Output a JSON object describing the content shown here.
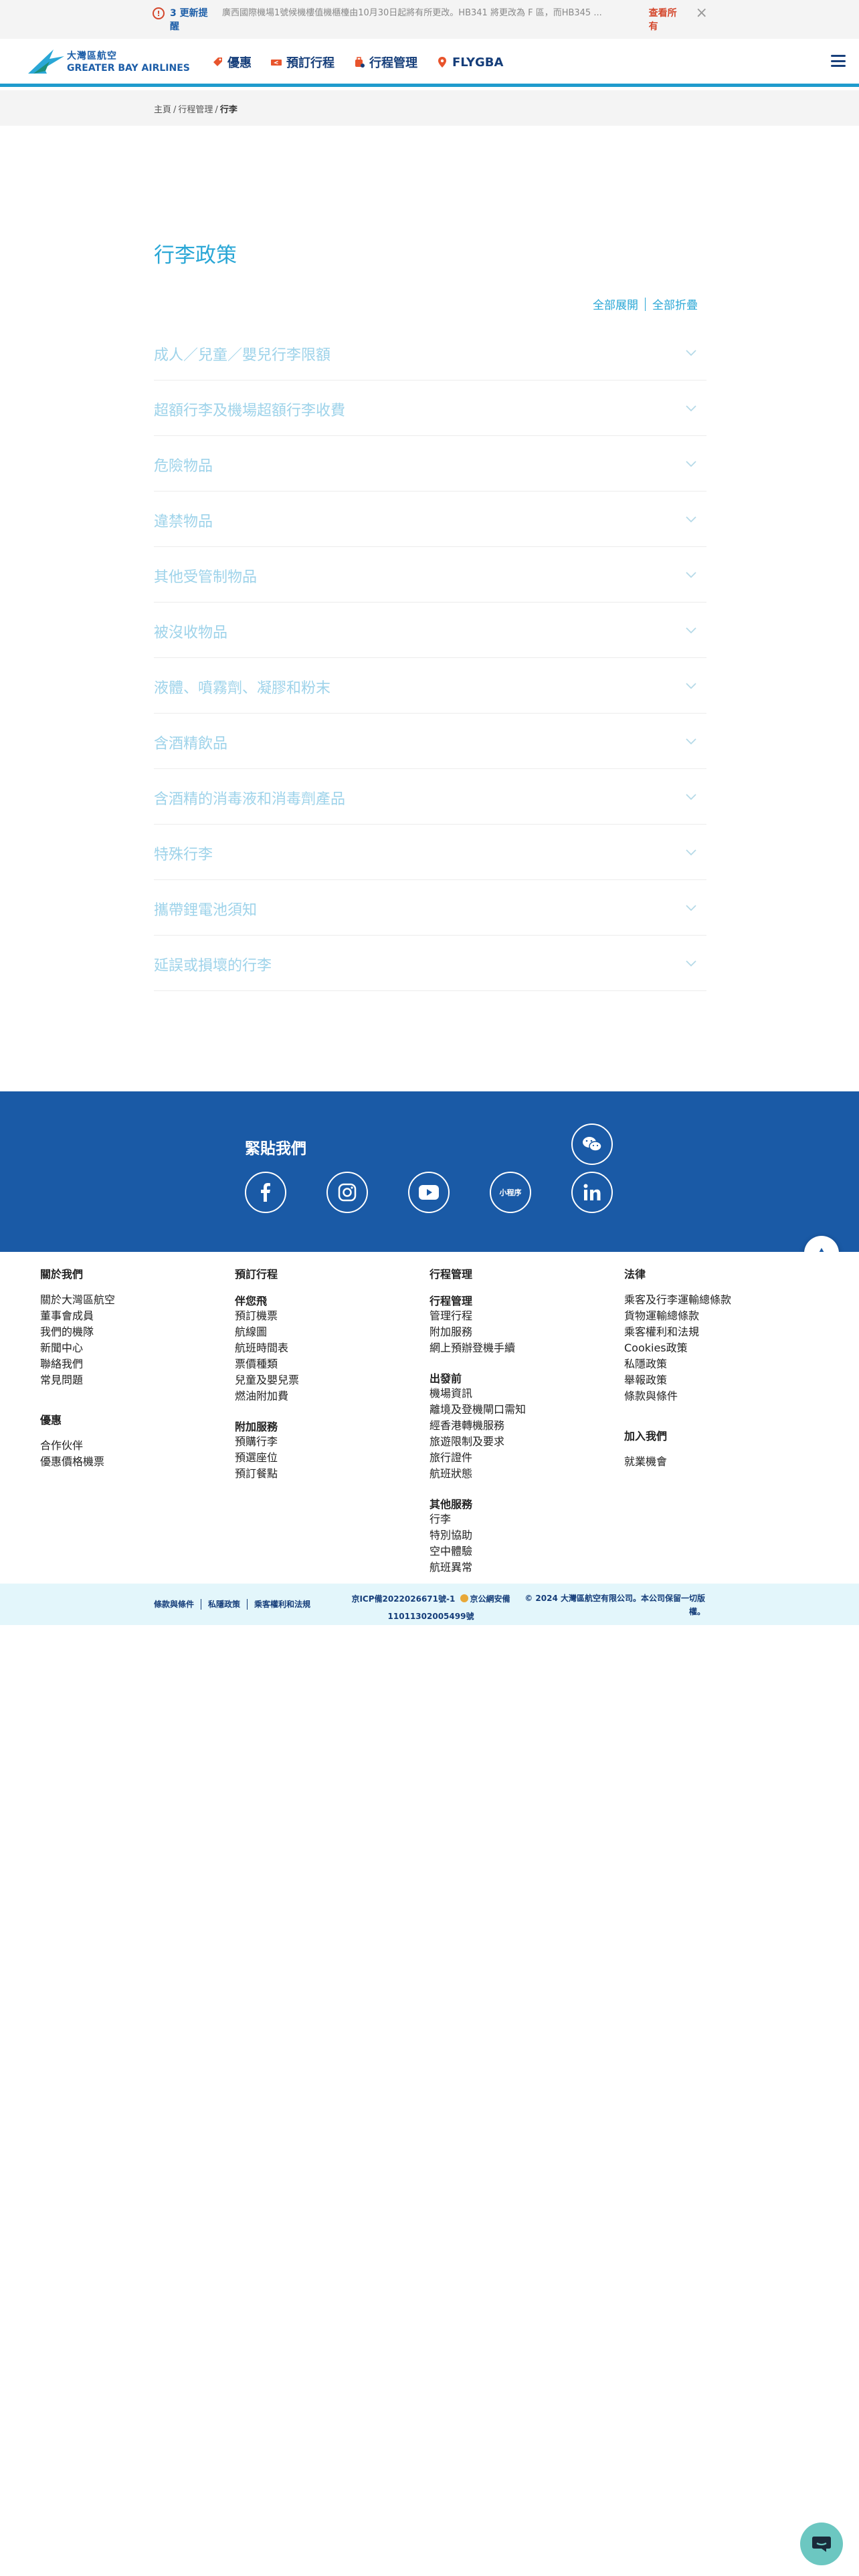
{
  "alert": {
    "icon": "alert-circle-icon",
    "count": "3 更新提醒",
    "text": "廣西國際機場1號候機樓值機櫃檯由10月30日起將有所更改。HB341 將更改為 F 區，而HB345 ...",
    "link": "查看所有",
    "color": "#d4462b"
  },
  "header": {
    "logo_cn": "大灣區航空",
    "logo_en": "GREATER BAY AIRLINES",
    "nav": [
      {
        "label": "優惠",
        "icon": "tag-icon"
      },
      {
        "label": "預訂行程",
        "icon": "airplane-ticket-icon"
      },
      {
        "label": "行程管理",
        "icon": "luggage-icon"
      },
      {
        "label": "FLYGBA",
        "icon": "location-pin-icon"
      }
    ],
    "accent": "#1f9bcd"
  },
  "breadcrumb": {
    "items": [
      "主頁",
      "行程管理"
    ],
    "current": "行李"
  },
  "main": {
    "title": "行李政策",
    "expand_all": "全部展開",
    "collapse_all": "全部折疊",
    "accordion": [
      "成人／兒童／嬰兒行李限額",
      "超額行李及機場超額行李收費",
      "危險物品",
      "違禁物品",
      "其他受管制物品",
      "被沒收物品",
      "液體、噴霧劑、凝膠和粉末",
      "含酒精飲品",
      "含酒精的消毒液和消毒劑產品",
      "特殊行李",
      "攜帶鋰電池須知",
      "延誤或損壞的行李"
    ]
  },
  "social": {
    "title": "緊貼我們",
    "band_color": "#1a5aa6",
    "icons": [
      "wechat-icon",
      "facebook-icon",
      "instagram-icon",
      "youtube-icon",
      "mini-program-icon",
      "linkedin-icon"
    ],
    "mini_program_label": "小程序"
  },
  "footer": {
    "about": {
      "title": "關於我們",
      "links": [
        "關於大灣區航空",
        "董事會成員",
        "我們的機隊",
        "新聞中心",
        "聯絡我們",
        "常見問題"
      ]
    },
    "offers": {
      "title": "優惠",
      "links": [
        "合作伙伴",
        "優惠價格機票"
      ]
    },
    "booking": {
      "title": "預訂行程",
      "fly_title": "伴您飛",
      "fly_links": [
        "預訂機票",
        "航線圖",
        "航班時間表",
        "票價種類",
        "兒童及嬰兒票",
        "燃油附加費"
      ],
      "extra_title": "附加服務",
      "extra_links": [
        "預購行李",
        "預選座位",
        "預訂餐點"
      ]
    },
    "manage": {
      "title": "行程管理",
      "manage_title": "行程管理",
      "manage_links": [
        "管理行程",
        "附加服務",
        "網上預辦登機手續"
      ],
      "depart_title": "出發前",
      "depart_links": [
        "機場資訊",
        "離境及登機閘口需知",
        "經香港轉機服務",
        "旅遊限制及要求",
        "旅行證件",
        "航班狀態"
      ],
      "other_title": "其他服務",
      "other_links": [
        "行李",
        "特別協助",
        "空中體驗",
        "航班異常"
      ]
    },
    "legal": {
      "title": "法律",
      "links": [
        "乘客及行李運輸總條款",
        "貨物運輸總條款",
        "乘客權利和法規",
        "Cookies政策",
        "私隱政策",
        "舉報政策",
        "條款與條件"
      ]
    },
    "join": {
      "title": "加入我們",
      "links": [
        "就業機會"
      ]
    }
  },
  "legal_bar": {
    "links": [
      "條款與條件",
      "私隱政策",
      "乘客權利和法規"
    ],
    "icp_line1": "京ICP備2022026671號-1",
    "icp_line1b": "京公網安備",
    "icp_line2": "11011302005499號",
    "copyright": "© 2024 大灣區航空有限公司。本公司保留一切版權。"
  }
}
